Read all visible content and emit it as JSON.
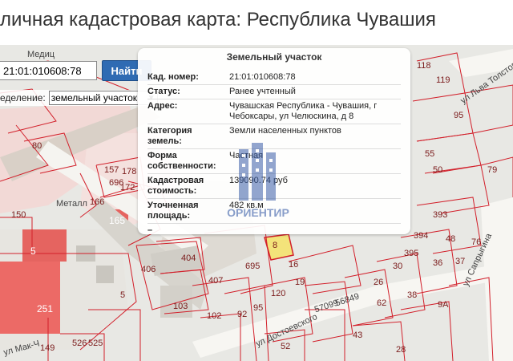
{
  "page": {
    "title": "личная кадастровая карта: Республика Чувашия"
  },
  "search": {
    "value": "21:01:010608:78",
    "button_label": "Найти"
  },
  "filter": {
    "label": "еделение:",
    "selected": "земельный участок"
  },
  "info_panel": {
    "title": "Земельный участок",
    "rows": [
      {
        "key": "Кад. номер:",
        "value": "21:01:010608:78"
      },
      {
        "key": "Статус:",
        "value": "Ранее учтенный"
      },
      {
        "key": "Адрес:",
        "value": "Чувашская Республика - Чувашия, г Чебоксары, ул Челюскина, д 8"
      },
      {
        "key": "Категория земель:",
        "value": "Земли населенных пунктов"
      },
      {
        "key": "Форма собственности:",
        "value": "Частная"
      },
      {
        "key": "Кадастровая стоимость:",
        "value": "139090.74 руб"
      },
      {
        "key": "Уточненная площадь:",
        "value": "482 кв.м"
      },
      {
        "key": "–",
        "value": ""
      }
    ]
  },
  "watermark": {
    "text": "ОРИЕНТИР"
  },
  "map": {
    "labels": {
      "l80": "80",
      "l150": "150",
      "l157": "157",
      "l178": "178",
      "l696": "696",
      "l172": "172",
      "l166": "166",
      "l165": "165",
      "l5a": "5",
      "l5b": "5",
      "l251": "251",
      "l149": "149",
      "l526": "526",
      "l525": "525",
      "l404": "404",
      "l406": "406",
      "l407": "407",
      "l103": "103",
      "l102": "102",
      "l92": "92",
      "l95": "95",
      "l695": "695",
      "l120": "120",
      "l16": "16",
      "l19": "19",
      "l8": "8",
      "l26": "26",
      "l30": "30",
      "l38": "38",
      "l62": "62",
      "l52": "52",
      "l43": "43",
      "l28": "28",
      "l393": "393",
      "l394": "394",
      "l395": "395",
      "l36": "36",
      "l37": "37",
      "l48": "48",
      "l50": "50",
      "l55": "55",
      "l95b": "95",
      "l79": "79",
      "l76": "76",
      "l9a": "9А",
      "l119": "119",
      "l118": "118",
      "street1": "ул Льва Толстого",
      "street2": "ул Достоевского",
      "street3": "57099",
      "street4": "56849",
      "street5": "ул Сапрыгина",
      "street6": "Металл",
      "street7": "ул Мак-Ч",
      "street8": "Медиц"
    }
  },
  "colors": {
    "accent": "#2f6bb3",
    "parcel_line": "#d21f2a",
    "selected_parcel": "#f3e37a"
  }
}
